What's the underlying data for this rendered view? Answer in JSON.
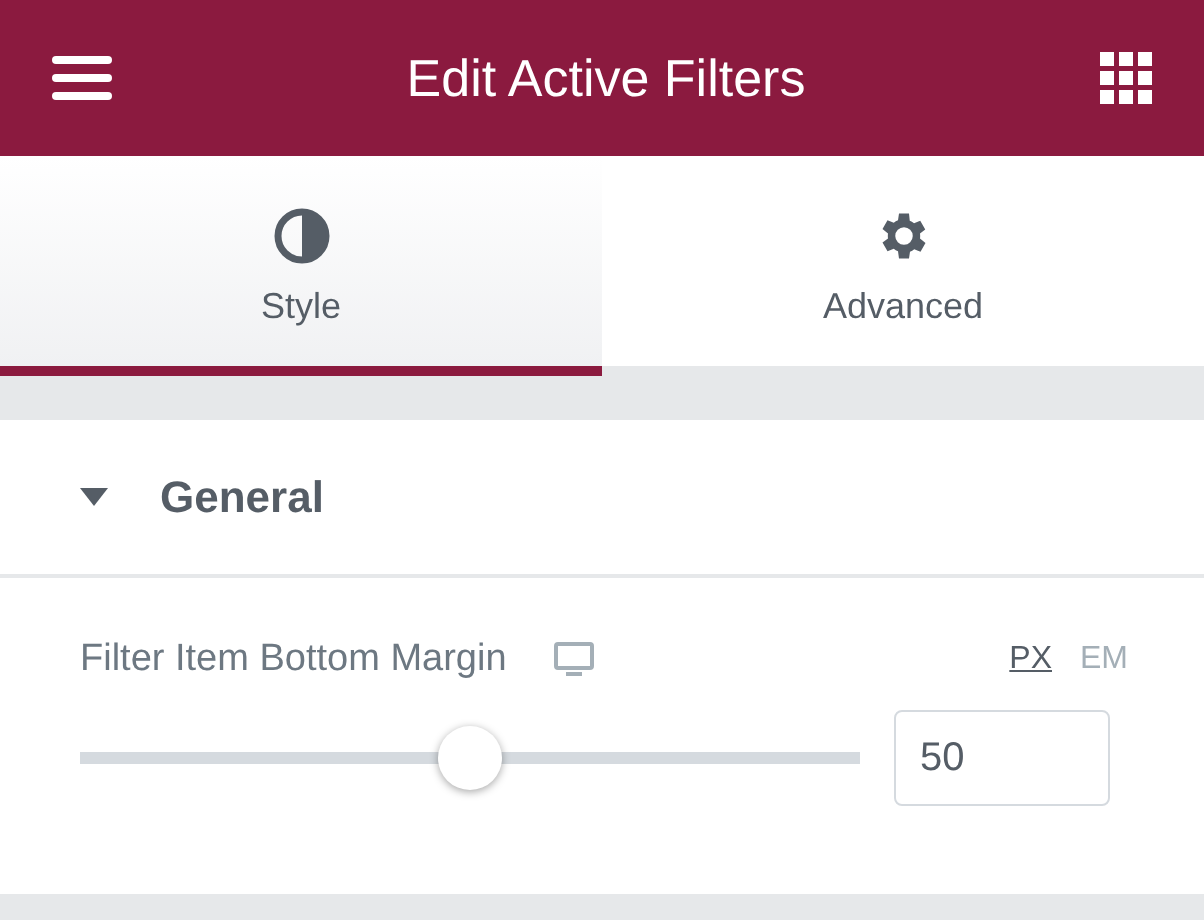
{
  "header": {
    "title": "Edit Active Filters"
  },
  "tabs": [
    {
      "label": "Style",
      "selected": true,
      "kind": "style"
    },
    {
      "label": "Advanced",
      "selected": false,
      "kind": "advanced"
    }
  ],
  "section": {
    "title": "General",
    "expanded": true
  },
  "control": {
    "label": "Filter Item Bottom Margin",
    "units": [
      {
        "label": "PX",
        "selected": true
      },
      {
        "label": "EM",
        "selected": false
      }
    ],
    "slider": {
      "level": 0.5
    },
    "value": "50"
  }
}
